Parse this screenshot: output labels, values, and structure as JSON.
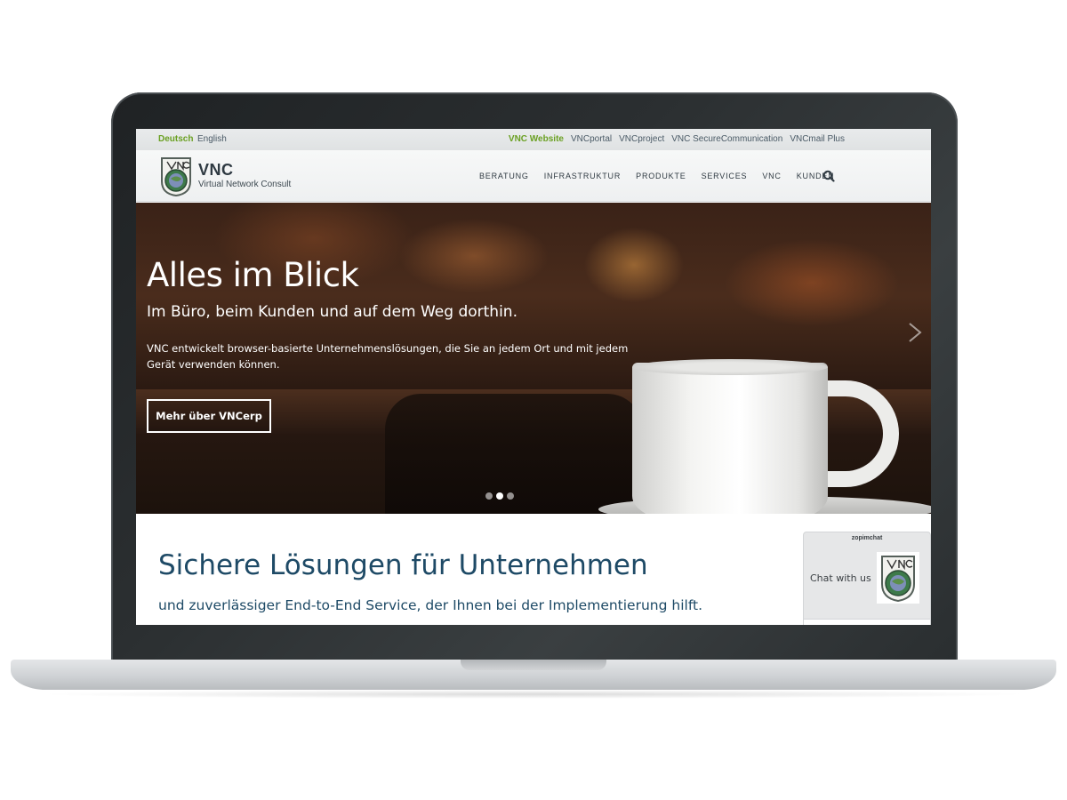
{
  "topbar": {
    "languages": [
      {
        "label": "Deutsch",
        "active": true
      },
      {
        "label": "English",
        "active": false
      }
    ],
    "site_links": [
      {
        "label": "VNC Website",
        "active": true
      },
      {
        "label": "VNCportal",
        "active": false
      },
      {
        "label": "VNCproject",
        "active": false
      },
      {
        "label": "VNC SecureCommunication",
        "active": false
      },
      {
        "label": "VNCmail Plus",
        "active": false
      }
    ]
  },
  "header": {
    "logo_title": "VNC",
    "logo_subtitle": "Virtual Network Consult",
    "menu": [
      "BERATUNG",
      "INFRASTRUKTUR",
      "PRODUKTE",
      "SERVICES",
      "VNC",
      "KUNDEN"
    ],
    "search_icon": "search-icon"
  },
  "hero": {
    "title": "Alles im Blick",
    "subtitle": "Im Büro, beim Kunden und auf dem Weg dorthin.",
    "text": "VNC entwickelt browser-basierte Unternehmenslösungen, die Sie an jedem Ort und mit jedem Gerät verwenden können.",
    "button_label": "Mehr über VNCerp",
    "slides_total": 3,
    "active_slide": 2,
    "next_icon": "chevron-right-icon"
  },
  "intro": {
    "title": "Sichere Lösungen für Unternehmen",
    "subtitle": "und zuverlässiger End-to-End Service, der Ihnen bei der Implementierung hilft."
  },
  "chat": {
    "brand": "zopimchat",
    "label": "Chat with us"
  },
  "colors": {
    "accent_green": "#6aa022",
    "heading_blue": "#1e4a66",
    "nav_text": "#2f3a42"
  }
}
